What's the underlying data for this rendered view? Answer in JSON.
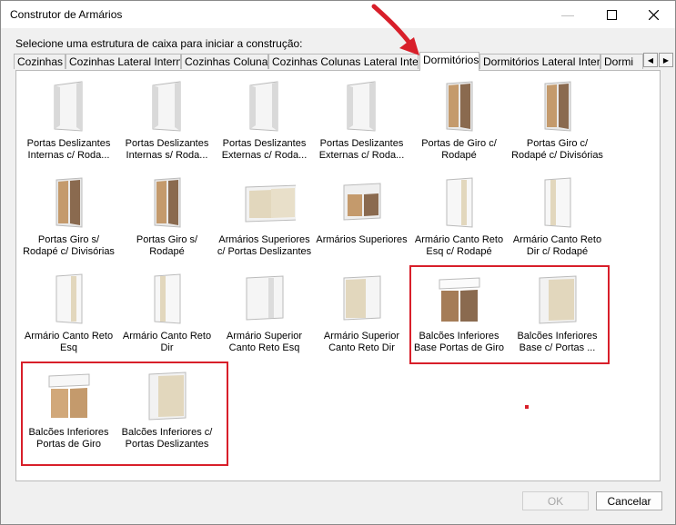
{
  "window": {
    "title": "Construtor de Armários"
  },
  "instruction": "Selecione uma estrutura de caixa para iniciar a construção:",
  "tabs": [
    {
      "label": "Cozinhas",
      "active": false
    },
    {
      "label": "Cozinhas Lateral Interna",
      "active": false
    },
    {
      "label": "Cozinhas Colunas",
      "active": false
    },
    {
      "label": "Cozinhas Colunas Lateral Interna",
      "active": false
    },
    {
      "label": "Dormitórios",
      "active": true
    },
    {
      "label": "Dormitórios Lateral Interna",
      "active": false
    },
    {
      "label": "Dormi",
      "active": false
    }
  ],
  "items": [
    {
      "line1": "Portas Deslizantes",
      "line2": "Internas c/ Roda...",
      "icon": "tall-cabinet-open-icon"
    },
    {
      "line1": "Portas Deslizantes",
      "line2": "Internas s/ Roda...",
      "icon": "tall-cabinet-open-icon"
    },
    {
      "line1": "Portas Deslizantes",
      "line2": "Externas c/ Roda...",
      "icon": "tall-cabinet-open-icon"
    },
    {
      "line1": "Portas Deslizantes",
      "line2": "Externas c/ Roda...",
      "icon": "tall-cabinet-open-icon"
    },
    {
      "line1": "Portas de Giro c/",
      "line2": "Rodapé",
      "icon": "tall-cabinet-doors-icon"
    },
    {
      "line1": "Portas Giro c/",
      "line2": "Rodapé c/ Divisórias",
      "icon": "tall-cabinet-doors-icon"
    },
    {
      "line1": "Portas Giro s/",
      "line2": "Rodapé c/ Divisórias",
      "icon": "tall-cabinet-doors-icon"
    },
    {
      "line1": "Portas Giro s/",
      "line2": "Rodapé",
      "icon": "tall-cabinet-doors-icon"
    },
    {
      "line1": "Armários Superiores",
      "line2": "c/ Portas Deslizantes",
      "icon": "wall-cabinet-sliding-icon"
    },
    {
      "line1": "Armários Superiores",
      "line2": "",
      "icon": "wall-cabinet-icon"
    },
    {
      "line1": "Armário Canto Reto",
      "line2": "Esq c/ Rodapé",
      "icon": "corner-cabinet-icon"
    },
    {
      "line1": "Armário Canto Reto",
      "line2": "Dir c/ Rodapé",
      "icon": "corner-cabinet-icon"
    },
    {
      "line1": "Armário Canto Reto",
      "line2": "Esq",
      "icon": "corner-cabinet-icon"
    },
    {
      "line1": "Armário Canto Reto",
      "line2": "Dir",
      "icon": "corner-cabinet-icon"
    },
    {
      "line1": "Armário Superior",
      "line2": "Canto Reto Esq",
      "icon": "corner-wall-cabinet-icon"
    },
    {
      "line1": "Armário Superior",
      "line2": "Canto Reto Dir",
      "icon": "corner-wall-cabinet-icon"
    },
    {
      "line1": "Balcões Inferiores",
      "line2": "Base Portas de Giro",
      "icon": "base-cabinet-doors-icon"
    },
    {
      "line1": "Balcões Inferiores",
      "line2": "Base c/ Portas ...",
      "icon": "base-cabinet-sliding-icon"
    },
    {
      "line1": "Balcões Inferiores",
      "line2": "Portas de Giro",
      "icon": "base-cabinet-open-top-icon"
    },
    {
      "line1": "Balcões Inferiores c/",
      "line2": "Portas Deslizantes",
      "icon": "base-cabinet-sliding-icon"
    }
  ],
  "buttons": {
    "ok": "OK",
    "cancel": "Cancelar"
  },
  "colors": {
    "highlight": "#d81f2a",
    "wood": "#c49a6c",
    "beige": "#e2d7bd",
    "white_panel": "#f4f4f4"
  }
}
